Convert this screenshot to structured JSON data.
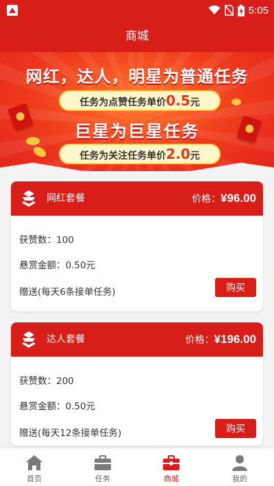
{
  "status_bar": {
    "time": "5:05",
    "icons": [
      "app-icon",
      "wifi-icon",
      "no-sim-icon",
      "battery-charging-icon"
    ]
  },
  "app_bar": {
    "title": "商城"
  },
  "banner": {
    "headline": "网红，达人，明星为普通任务",
    "pill1_text": "任务为点赞任务单价",
    "pill1_price": "0.5",
    "pill1_unit": "元",
    "subheadline": "巨星为巨星任务",
    "pill2_text": "任务为关注任务单价",
    "pill2_price": "2.0",
    "pill2_unit": "元"
  },
  "packages": [
    {
      "name": "网红套餐",
      "price_label": "价格：",
      "price": "¥96.00",
      "likes": "获赞数：100",
      "reward": "悬赏金额：0.50元",
      "gift": "赠送(每天6条接单任务)",
      "buy_label": "购买"
    },
    {
      "name": "达人套餐",
      "price_label": "价格：",
      "price": "¥196.00",
      "likes": "获赞数：200",
      "reward": "悬赏金额：0.50元",
      "gift": "赠送(每天12条接单任务)",
      "buy_label": "购买"
    }
  ],
  "tabs": [
    {
      "label": "首页",
      "icon": "home-icon",
      "active": false
    },
    {
      "label": "任务",
      "icon": "briefcase-icon",
      "active": false
    },
    {
      "label": "商城",
      "icon": "shop-bag-icon",
      "active": true
    },
    {
      "label": "我的",
      "icon": "person-icon",
      "active": false
    }
  ],
  "colors": {
    "brand_red": "#d81e18",
    "tab_inactive": "#7a7a7a",
    "price_highlight": "#e8341c"
  }
}
